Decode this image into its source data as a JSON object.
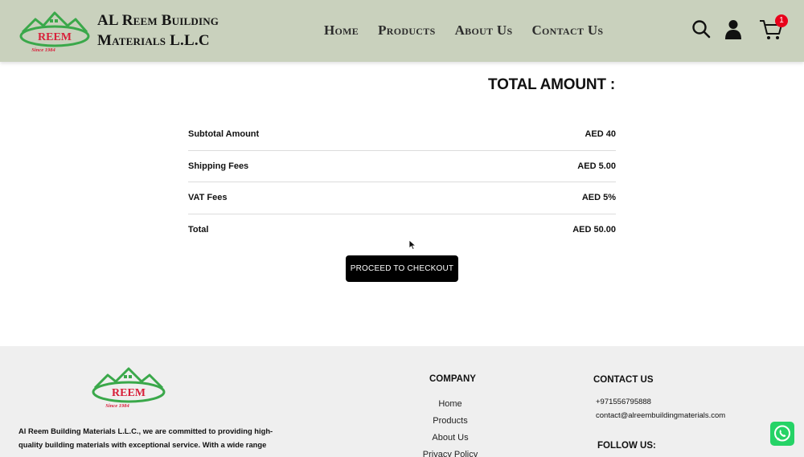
{
  "header": {
    "brand_line1": "AL Reem Building",
    "brand_line2": "Materials L.L.C",
    "logo_text": "REEM",
    "logo_since": "Since 1984",
    "nav": [
      "Home",
      "Products",
      "About Us",
      "Contact Us"
    ],
    "cart_count": "1",
    "icons": [
      "search-icon",
      "user-icon",
      "cart-icon"
    ]
  },
  "totals": {
    "title": "TOTAL AMOUNT :",
    "rows": [
      {
        "label": "Subtotal Amount",
        "value": "AED 40"
      },
      {
        "label": "Shipping Fees",
        "value": "AED 5.00"
      },
      {
        "label": "VAT Fees",
        "value": "AED 5%"
      },
      {
        "label": "Total",
        "value": "AED 50.00"
      }
    ],
    "checkout_label": "PROCEED TO CHECKOUT"
  },
  "footer": {
    "logo_text": "REEM",
    "logo_since": "Since 1984",
    "about_line1": "Al Reem Building Materials L.L.C., we are committed to providing high-",
    "about_line2": "quality building materials with exceptional service. With a wide range",
    "company_title": "COMPANY",
    "company_links": [
      "Home",
      "Products",
      "About Us",
      "Privacy Policy"
    ],
    "contact_title": "CONTACT US",
    "phone": "+971556795888",
    "email": "contact@alreembuildingmaterials.com",
    "follow_title": "FOLLOW US:"
  },
  "colors": {
    "header_bg": "#c9d1bd",
    "logo_green": "#3aa84a",
    "logo_red": "#d8203a",
    "badge_red": "#e8001b",
    "footer_bg": "#efefef",
    "whatsapp_green": "#25d366"
  }
}
